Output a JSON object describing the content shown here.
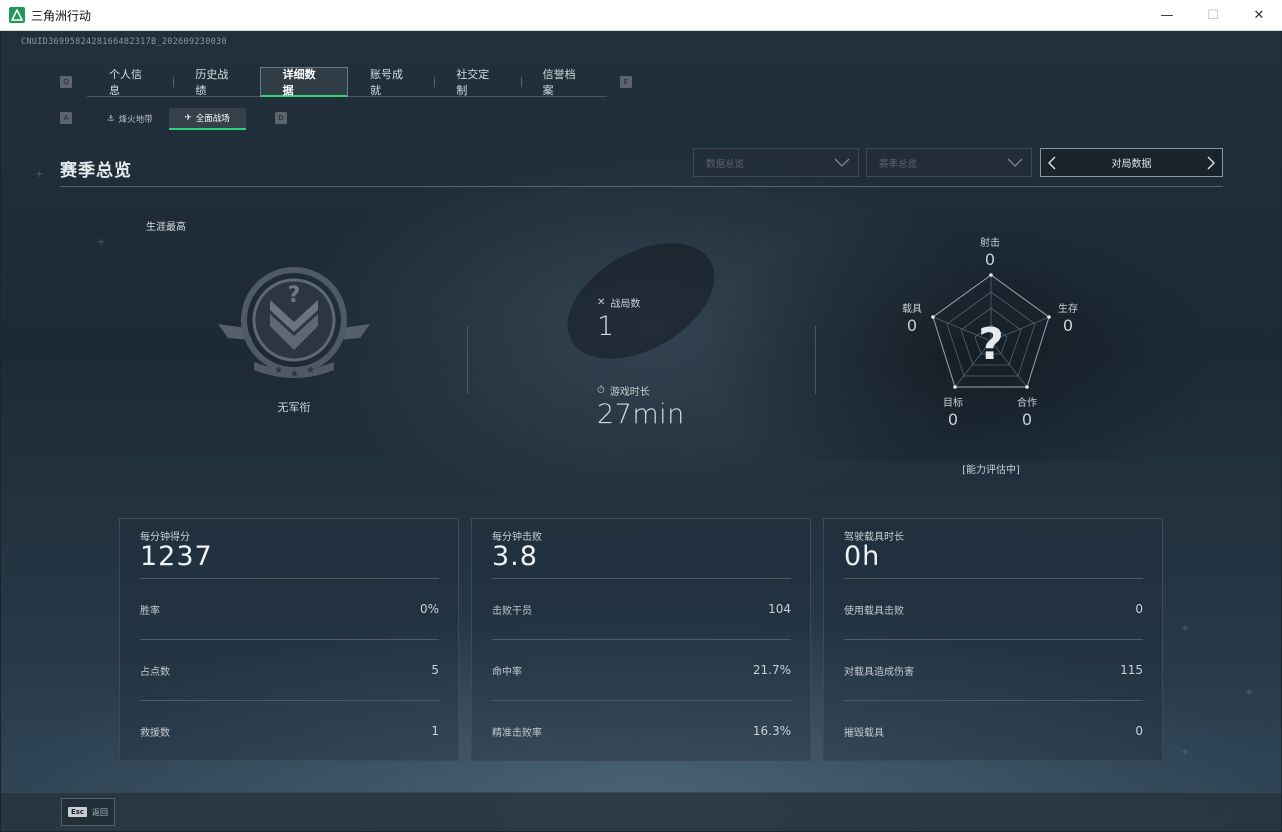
{
  "window": {
    "title": "三角洲行动",
    "min": "—",
    "max": "☐",
    "close": "✕"
  },
  "uid": "CNUID3699582428166482317B_202609230030",
  "key_hints": {
    "tab_left": "Q",
    "tab_right": "E",
    "sub_left": "A",
    "sub_right": "D"
  },
  "main_tabs": [
    {
      "label": "个人信息"
    },
    {
      "label": "历史战绩"
    },
    {
      "label": "详细数据"
    },
    {
      "label": "账号成就"
    },
    {
      "label": "社交定制"
    },
    {
      "label": "信誉档案"
    }
  ],
  "sub_tabs": [
    {
      "label": "烽火地带",
      "icon": "anchor-icon"
    },
    {
      "label": "全面战场",
      "icon": "wings-icon"
    }
  ],
  "page_title": "赛季总览",
  "filters": {
    "data_overview": "数据总览",
    "season_overview": "赛季总览",
    "match_data": "对局数据"
  },
  "rank": {
    "career_label": "生涯最高",
    "name": "无军衔"
  },
  "battle": {
    "matches_label": "战局数",
    "matches_value": "1",
    "time_label": "游戏时长",
    "time_value": "27min"
  },
  "radar": {
    "axes": [
      {
        "label": "射击",
        "value": "0"
      },
      {
        "label": "生存",
        "value": "0"
      },
      {
        "label": "合作",
        "value": "0"
      },
      {
        "label": "目标",
        "value": "0"
      },
      {
        "label": "载具",
        "value": "0"
      }
    ],
    "center": "?",
    "note": "[能力评估中]"
  },
  "cards": [
    {
      "title": "每分钟得分",
      "main": "1237",
      "rows": [
        {
          "label": "胜率",
          "value": "0%"
        },
        {
          "label": "占点数",
          "value": "5"
        },
        {
          "label": "救援数",
          "value": "1"
        }
      ]
    },
    {
      "title": "每分钟击败",
      "main": "3.8",
      "rows": [
        {
          "label": "击败干员",
          "value": "104"
        },
        {
          "label": "命中率",
          "value": "21.7%"
        },
        {
          "label": "精准击败率",
          "value": "16.3%"
        }
      ]
    },
    {
      "title": "驾驶载具时长",
      "main": "0h",
      "rows": [
        {
          "label": "使用载具击败",
          "value": "0"
        },
        {
          "label": "对载具造成伤害",
          "value": "115"
        },
        {
          "label": "摧毁载具",
          "value": "0"
        }
      ]
    }
  ],
  "footer": {
    "esc_key": "Esc",
    "esc_label": "返回"
  },
  "colors": {
    "accent": "#2fd27a",
    "text": "#c9d0d6"
  }
}
